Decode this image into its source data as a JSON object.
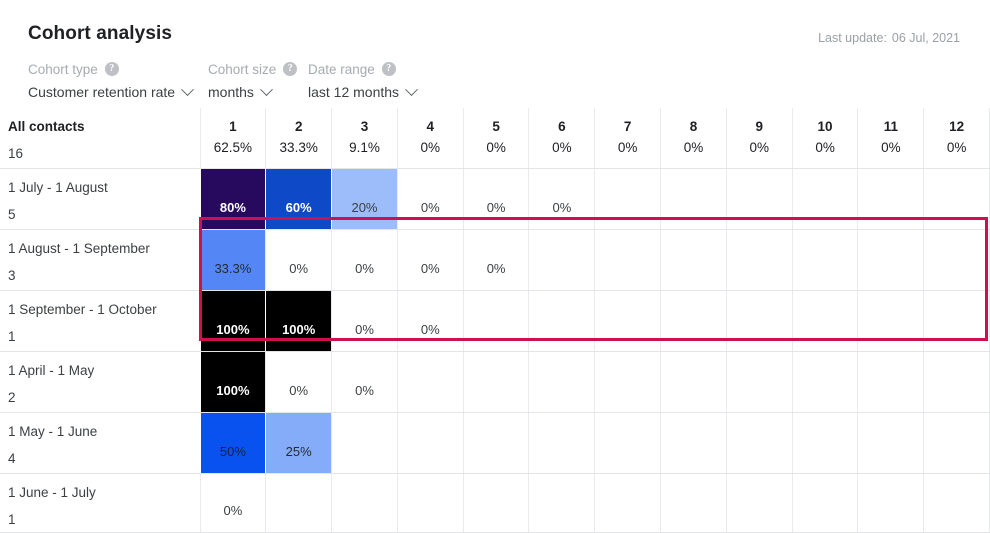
{
  "header": {
    "title": "Cohort analysis",
    "last_update_label": "Last update:",
    "last_update_value": "06 Jul, 2021"
  },
  "controls": {
    "cohort_type": {
      "label": "Cohort type",
      "help_icon": "help-circle-icon",
      "value": "Customer retention rate",
      "chevron": "chevron-down-icon"
    },
    "cohort_size": {
      "label": "Cohort size",
      "help_icon": "help-circle-icon",
      "value": "months",
      "chevron": "chevron-down-icon"
    },
    "date_range": {
      "label": "Date range",
      "help_icon": "help-circle-icon",
      "value": "last 12 months",
      "chevron": "chevron-down-icon"
    }
  },
  "colors": {
    "highlight_frame": "#cc1050",
    "fill_100": "#000000",
    "fill_80": "#27095e",
    "fill_60": "#0e4ac8",
    "fill_50": "#0a52f0",
    "fill_33": "#5487f5",
    "fill_25": "#85acf8",
    "fill_20": "#9cbdfa",
    "grid_line": "#e3e5e8"
  },
  "table": {
    "columns": [
      "1",
      "2",
      "3",
      "4",
      "5",
      "6",
      "7",
      "8",
      "9",
      "10",
      "11",
      "12"
    ],
    "summary_row": {
      "name": "All contacts",
      "size": "16",
      "values": [
        "62.5%",
        "33.3%",
        "9.1%",
        "0%",
        "0%",
        "0%",
        "0%",
        "0%",
        "0%",
        "0%",
        "0%",
        "0%"
      ]
    },
    "rows": [
      {
        "name": "1 July - 1 August",
        "size": "5",
        "highlighted": true,
        "cells": [
          {
            "value": "80%",
            "fill": "#27095e",
            "text": "#ffffff",
            "bold": true
          },
          {
            "value": "60%",
            "fill": "#0e4ac8",
            "text": "#ffffff",
            "bold": true
          },
          {
            "value": "20%",
            "fill": "#9cbdfa",
            "text": "#3c4043",
            "bold": false
          },
          {
            "value": "0%",
            "fill": "",
            "text": "#3c4043",
            "bold": false
          },
          {
            "value": "0%",
            "fill": "",
            "text": "#3c4043",
            "bold": false
          },
          {
            "value": "0%",
            "fill": "",
            "text": "#3c4043",
            "bold": false
          },
          {
            "value": "",
            "fill": "",
            "text": "#3c4043",
            "bold": false
          },
          {
            "value": "",
            "fill": "",
            "text": "#3c4043",
            "bold": false
          },
          {
            "value": "",
            "fill": "",
            "text": "#3c4043",
            "bold": false
          },
          {
            "value": "",
            "fill": "",
            "text": "#3c4043",
            "bold": false
          },
          {
            "value": "",
            "fill": "",
            "text": "#3c4043",
            "bold": false
          },
          {
            "value": "",
            "fill": "",
            "text": "#3c4043",
            "bold": false
          }
        ]
      },
      {
        "name": "1 August - 1 September",
        "size": "3",
        "highlighted": false,
        "cells": [
          {
            "value": "33.3%",
            "fill": "#5487f5",
            "text": "#262b33",
            "bold": false
          },
          {
            "value": "0%",
            "fill": "",
            "text": "#3c4043",
            "bold": false
          },
          {
            "value": "0%",
            "fill": "",
            "text": "#3c4043",
            "bold": false
          },
          {
            "value": "0%",
            "fill": "",
            "text": "#3c4043",
            "bold": false
          },
          {
            "value": "0%",
            "fill": "",
            "text": "#3c4043",
            "bold": false
          },
          {
            "value": "",
            "fill": "",
            "text": "#3c4043",
            "bold": false
          },
          {
            "value": "",
            "fill": "",
            "text": "#3c4043",
            "bold": false
          },
          {
            "value": "",
            "fill": "",
            "text": "#3c4043",
            "bold": false
          },
          {
            "value": "",
            "fill": "",
            "text": "#3c4043",
            "bold": false
          },
          {
            "value": "",
            "fill": "",
            "text": "#3c4043",
            "bold": false
          },
          {
            "value": "",
            "fill": "",
            "text": "#3c4043",
            "bold": false
          },
          {
            "value": "",
            "fill": "",
            "text": "#3c4043",
            "bold": false
          }
        ]
      },
      {
        "name": "1 September - 1 October",
        "size": "1",
        "highlighted": false,
        "cells": [
          {
            "value": "100%",
            "fill": "#000000",
            "text": "#ffffff",
            "bold": true
          },
          {
            "value": "100%",
            "fill": "#000000",
            "text": "#ffffff",
            "bold": true
          },
          {
            "value": "0%",
            "fill": "",
            "text": "#3c4043",
            "bold": false
          },
          {
            "value": "0%",
            "fill": "",
            "text": "#3c4043",
            "bold": false
          },
          {
            "value": "",
            "fill": "",
            "text": "#3c4043",
            "bold": false
          },
          {
            "value": "",
            "fill": "",
            "text": "#3c4043",
            "bold": false
          },
          {
            "value": "",
            "fill": "",
            "text": "#3c4043",
            "bold": false
          },
          {
            "value": "",
            "fill": "",
            "text": "#3c4043",
            "bold": false
          },
          {
            "value": "",
            "fill": "",
            "text": "#3c4043",
            "bold": false
          },
          {
            "value": "",
            "fill": "",
            "text": "#3c4043",
            "bold": false
          },
          {
            "value": "",
            "fill": "",
            "text": "#3c4043",
            "bold": false
          },
          {
            "value": "",
            "fill": "",
            "text": "#3c4043",
            "bold": false
          }
        ]
      },
      {
        "name": "1 April - 1 May",
        "size": "2",
        "highlighted": false,
        "cells": [
          {
            "value": "100%",
            "fill": "#000000",
            "text": "#ffffff",
            "bold": true
          },
          {
            "value": "0%",
            "fill": "",
            "text": "#3c4043",
            "bold": false
          },
          {
            "value": "0%",
            "fill": "",
            "text": "#3c4043",
            "bold": false
          },
          {
            "value": "",
            "fill": "",
            "text": "#3c4043",
            "bold": false
          },
          {
            "value": "",
            "fill": "",
            "text": "#3c4043",
            "bold": false
          },
          {
            "value": "",
            "fill": "",
            "text": "#3c4043",
            "bold": false
          },
          {
            "value": "",
            "fill": "",
            "text": "#3c4043",
            "bold": false
          },
          {
            "value": "",
            "fill": "",
            "text": "#3c4043",
            "bold": false
          },
          {
            "value": "",
            "fill": "",
            "text": "#3c4043",
            "bold": false
          },
          {
            "value": "",
            "fill": "",
            "text": "#3c4043",
            "bold": false
          },
          {
            "value": "",
            "fill": "",
            "text": "#3c4043",
            "bold": false
          },
          {
            "value": "",
            "fill": "",
            "text": "#3c4043",
            "bold": false
          }
        ]
      },
      {
        "name": "1 May - 1 June",
        "size": "4",
        "highlighted": false,
        "cells": [
          {
            "value": "50%",
            "fill": "#0a52f0",
            "text": "#15203a",
            "bold": false
          },
          {
            "value": "25%",
            "fill": "#85acf8",
            "text": "#262b33",
            "bold": false
          },
          {
            "value": "",
            "fill": "",
            "text": "#3c4043",
            "bold": false
          },
          {
            "value": "",
            "fill": "",
            "text": "#3c4043",
            "bold": false
          },
          {
            "value": "",
            "fill": "",
            "text": "#3c4043",
            "bold": false
          },
          {
            "value": "",
            "fill": "",
            "text": "#3c4043",
            "bold": false
          },
          {
            "value": "",
            "fill": "",
            "text": "#3c4043",
            "bold": false
          },
          {
            "value": "",
            "fill": "",
            "text": "#3c4043",
            "bold": false
          },
          {
            "value": "",
            "fill": "",
            "text": "#3c4043",
            "bold": false
          },
          {
            "value": "",
            "fill": "",
            "text": "#3c4043",
            "bold": false
          },
          {
            "value": "",
            "fill": "",
            "text": "#3c4043",
            "bold": false
          },
          {
            "value": "",
            "fill": "",
            "text": "#3c4043",
            "bold": false
          }
        ]
      },
      {
        "name": "1 June - 1 July",
        "size": "1",
        "highlighted": false,
        "cells": [
          {
            "value": "0%",
            "fill": "",
            "text": "#3c4043",
            "bold": false
          },
          {
            "value": "",
            "fill": "",
            "text": "#3c4043",
            "bold": false
          },
          {
            "value": "",
            "fill": "",
            "text": "#3c4043",
            "bold": false
          },
          {
            "value": "",
            "fill": "",
            "text": "#3c4043",
            "bold": false
          },
          {
            "value": "",
            "fill": "",
            "text": "#3c4043",
            "bold": false
          },
          {
            "value": "",
            "fill": "",
            "text": "#3c4043",
            "bold": false
          },
          {
            "value": "",
            "fill": "",
            "text": "#3c4043",
            "bold": false
          },
          {
            "value": "",
            "fill": "",
            "text": "#3c4043",
            "bold": false
          },
          {
            "value": "",
            "fill": "",
            "text": "#3c4043",
            "bold": false
          },
          {
            "value": "",
            "fill": "",
            "text": "#3c4043",
            "bold": false
          },
          {
            "value": "",
            "fill": "",
            "text": "#3c4043",
            "bold": false
          },
          {
            "value": "",
            "fill": "",
            "text": "#3c4043",
            "bold": false
          }
        ]
      }
    ]
  }
}
